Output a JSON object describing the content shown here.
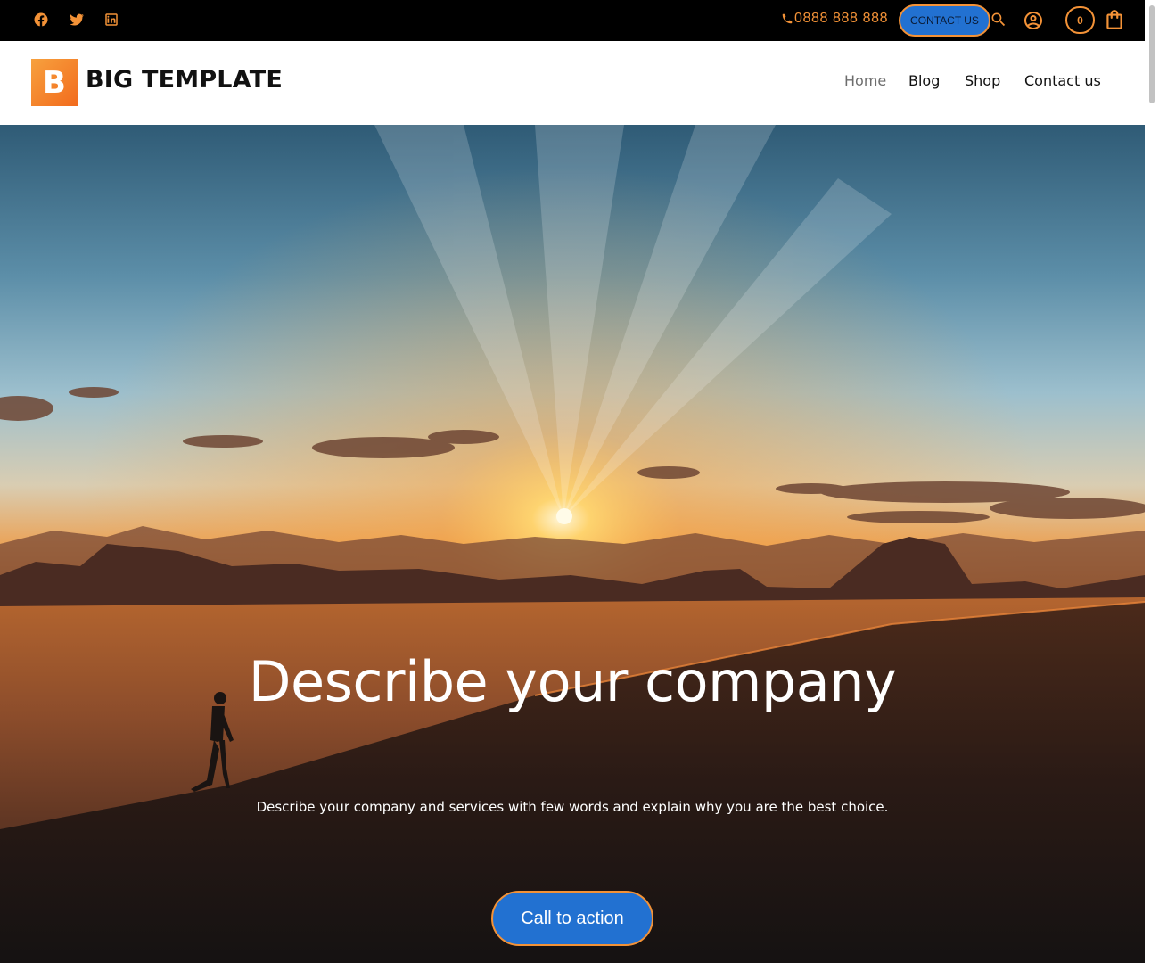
{
  "topbar": {
    "social_icons": [
      "facebook-icon",
      "twitter-icon",
      "linkedin-icon"
    ],
    "phone": "0888 888 888",
    "contact_button": "CONTACT US",
    "cart_count": "0"
  },
  "header": {
    "logo_letter": "B",
    "logo_text": "BIG TEMPLATE",
    "nav": [
      "Home",
      "Blog",
      "Shop",
      "Contact us"
    ],
    "active_nav": "Home"
  },
  "hero": {
    "title": "Describe your company",
    "subtitle": "Describe your company and services with few words and explain why you are the best choice.",
    "cta": "Call to action"
  },
  "colors": {
    "accent": "#f39237",
    "button": "#2271d1",
    "topbar_bg": "#000000"
  }
}
